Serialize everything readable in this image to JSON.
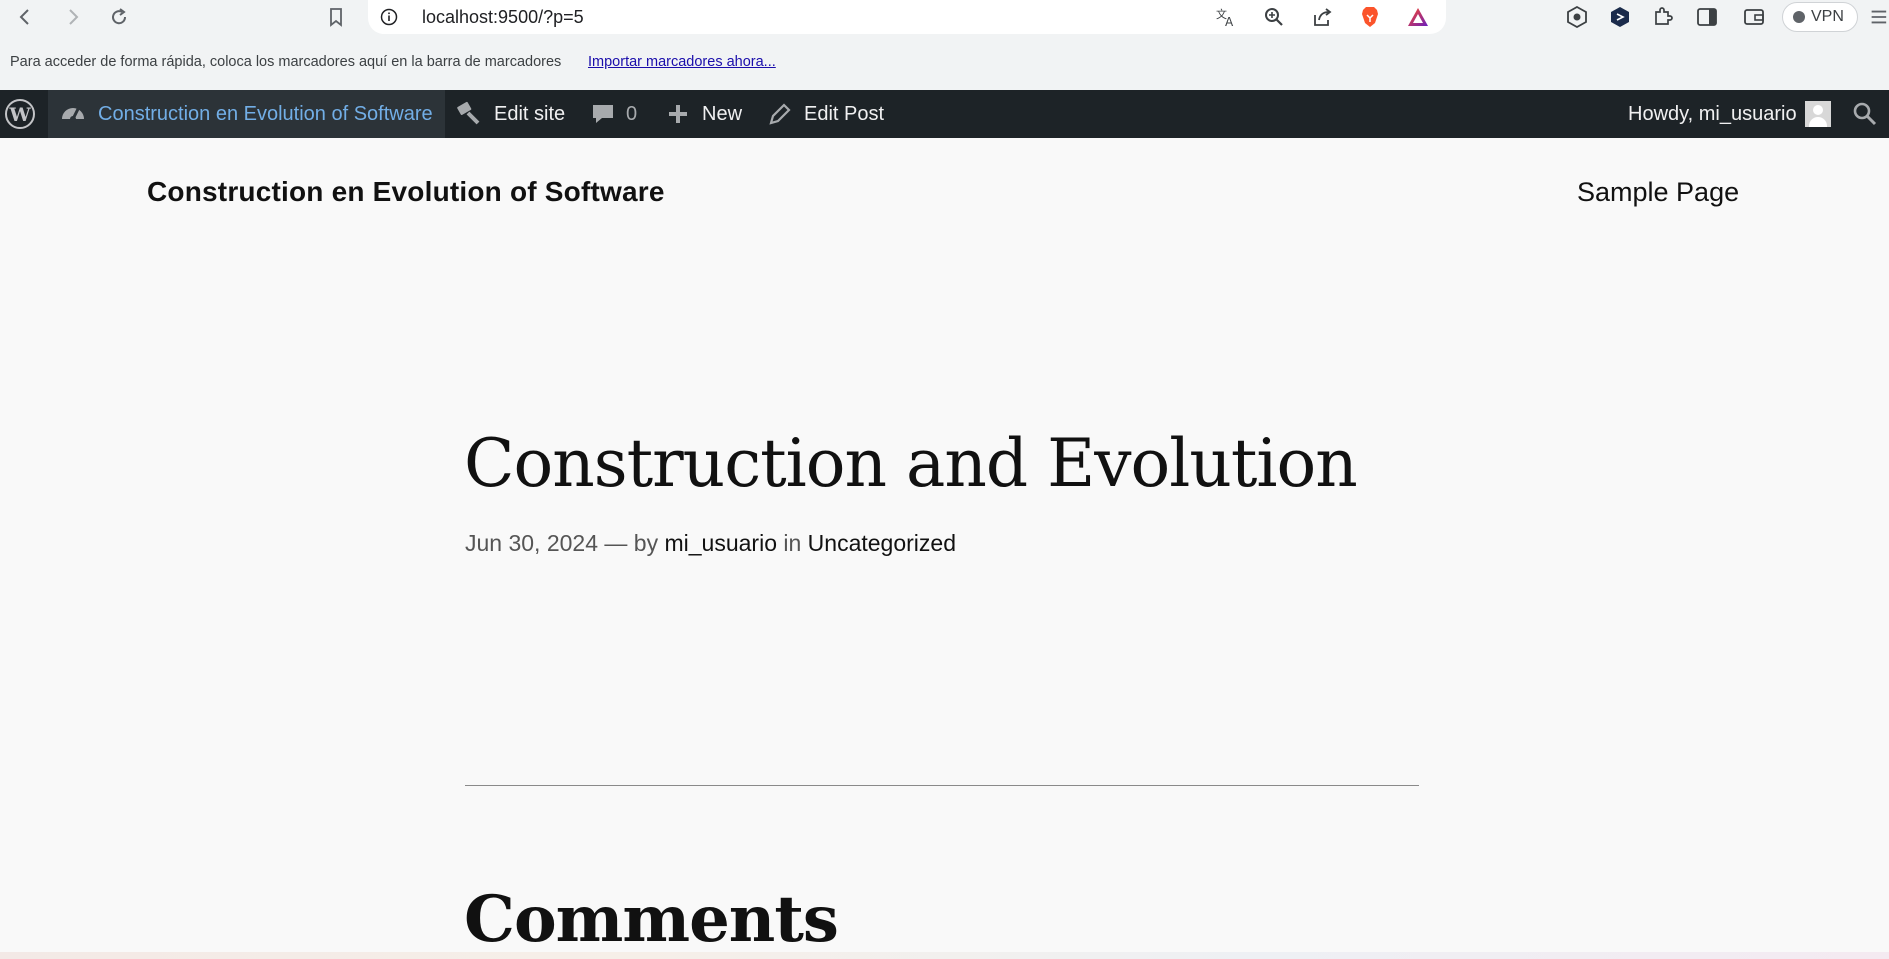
{
  "browser": {
    "url": "localhost:9500/?p=5",
    "vpn_label": "VPN"
  },
  "bookmarks_bar": {
    "hint": "Para acceder de forma rápida, coloca los marcadores aquí en la barra de marcadores",
    "import_link": "Importar marcadores ahora..."
  },
  "adminbar": {
    "site_name": "Construction en Evolution of Software",
    "edit_site": "Edit site",
    "comments_count": "0",
    "new_label": "New",
    "edit_post": "Edit Post",
    "howdy": "Howdy, mi_usuario",
    "accent_color": "#72aee6",
    "background_color": "#1d2327"
  },
  "site": {
    "title": "Construction en Evolution of Software",
    "nav": [
      "Sample Page"
    ]
  },
  "post": {
    "title": "Construction and Evolution",
    "date": "Jun 30, 2024",
    "dash_by": "— by",
    "author": "mi_usuario",
    "in_label": "in",
    "category": "Uncategorized"
  },
  "comments": {
    "heading": "Comments"
  }
}
